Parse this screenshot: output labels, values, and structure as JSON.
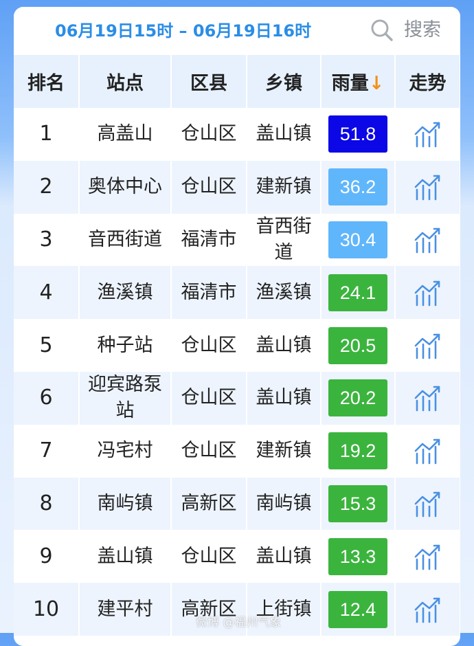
{
  "header": {
    "time_range": "06月19日15时 – 06月19日16时",
    "search_label": "搜索"
  },
  "table": {
    "columns": {
      "rank": "排名",
      "station": "站点",
      "district": "区县",
      "town": "乡镇",
      "rainfall": "雨量",
      "rainfall_sort_arrow": "↓",
      "trend": "走势"
    },
    "rows": [
      {
        "rank": "1",
        "station": "高盖山",
        "district": "仓山区",
        "town": "盖山镇",
        "rainfall": "51.8",
        "color": "#0b07e6"
      },
      {
        "rank": "2",
        "station": "奥体中心",
        "district": "仓山区",
        "town": "建新镇",
        "rainfall": "36.2",
        "color": "#60b6fb"
      },
      {
        "rank": "3",
        "station": "音西街道",
        "district": "福清市",
        "town": "音西街道",
        "rainfall": "30.4",
        "color": "#60b6fb"
      },
      {
        "rank": "4",
        "station": "渔溪镇",
        "district": "福清市",
        "town": "渔溪镇",
        "rainfall": "24.1",
        "color": "#3bb43e"
      },
      {
        "rank": "5",
        "station": "种子站",
        "district": "仓山区",
        "town": "盖山镇",
        "rainfall": "20.5",
        "color": "#3bb43e"
      },
      {
        "rank": "6",
        "station": "迎宾路泵站",
        "district": "仓山区",
        "town": "盖山镇",
        "rainfall": "20.2",
        "color": "#3bb43e"
      },
      {
        "rank": "7",
        "station": "冯宅村",
        "district": "仓山区",
        "town": "建新镇",
        "rainfall": "19.2",
        "color": "#3bb43e"
      },
      {
        "rank": "8",
        "station": "南屿镇",
        "district": "高新区",
        "town": "南屿镇",
        "rainfall": "15.3",
        "color": "#3bb43e"
      },
      {
        "rank": "9",
        "station": "盖山镇",
        "district": "仓山区",
        "town": "盖山镇",
        "rainfall": "13.3",
        "color": "#3bb43e"
      },
      {
        "rank": "10",
        "station": "建平村",
        "district": "高新区",
        "town": "上街镇",
        "rainfall": "12.4",
        "color": "#3bb43e"
      }
    ]
  },
  "icons": {
    "search": "search-icon",
    "trend": "trend-chart-icon"
  },
  "watermark": "微博 @福州气象"
}
